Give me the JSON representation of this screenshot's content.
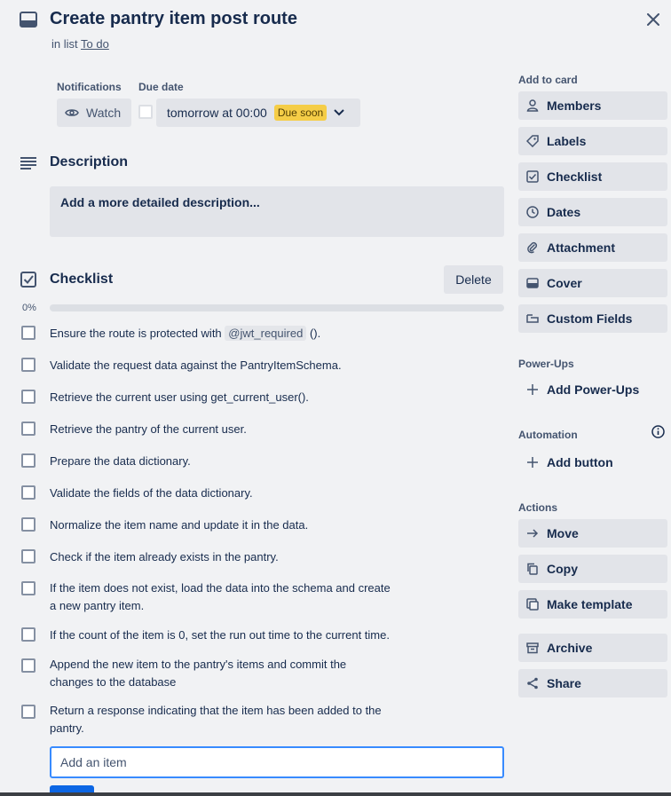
{
  "card": {
    "title": "Create pantry item post route",
    "in_list_prefix": "in list",
    "list_name": "To do"
  },
  "notifications": {
    "label": "Notifications",
    "watch_label": "Watch"
  },
  "due_date": {
    "label": "Due date",
    "value": "tomorrow at 00:00",
    "badge": "Due soon",
    "badge_color": "#f5cd47"
  },
  "description": {
    "title": "Description",
    "placeholder": "Add a more detailed description..."
  },
  "checklist": {
    "title": "Checklist",
    "delete_label": "Delete",
    "progress_percent": 0,
    "progress_label": "0%",
    "items": [
      {
        "text_before": "Ensure the route is protected with",
        "code": "@jwt_required",
        "text_after": "().",
        "checked": false
      },
      {
        "text": "Validate the request data against the PantryItemSchema.",
        "checked": false
      },
      {
        "text": "Retrieve the current user using get_current_user().",
        "checked": false
      },
      {
        "text": "Retrieve the pantry of the current user.",
        "checked": false
      },
      {
        "text": "Prepare the data dictionary.",
        "checked": false
      },
      {
        "text": "Validate the fields of the data dictionary.",
        "checked": false
      },
      {
        "text": "Normalize the item name and update it in the data.",
        "checked": false
      },
      {
        "text": "Check if the item already exists in the pantry.",
        "checked": false
      },
      {
        "line1": "If the item does not exist, load the data into the schema and create",
        "line2": "a new pantry item.",
        "checked": false
      },
      {
        "text": "If the count of the item is 0, set the run out time to the current time.",
        "checked": false
      },
      {
        "line1": "Append the new item to the pantry's items and commit the",
        "line2": "changes to the database",
        "checked": false
      },
      {
        "line1": "Return a response indicating that the item has been added to the",
        "line2": "pantry.",
        "checked": false
      }
    ],
    "add_item_placeholder": "Add an item"
  },
  "sidebar": {
    "add_to_card_label": "Add to card",
    "add_to_card": [
      {
        "label": "Members",
        "icon": "person-icon"
      },
      {
        "label": "Labels",
        "icon": "tag-icon"
      },
      {
        "label": "Checklist",
        "icon": "checklist-icon"
      },
      {
        "label": "Dates",
        "icon": "clock-icon"
      },
      {
        "label": "Attachment",
        "icon": "paperclip-icon"
      },
      {
        "label": "Cover",
        "icon": "cover-icon"
      },
      {
        "label": "Custom Fields",
        "icon": "custom-fields-icon"
      }
    ],
    "powerups_label": "Power-Ups",
    "add_powerups": "Add Power-Ups",
    "automation_label": "Automation",
    "add_button": "Add button",
    "actions_label": "Actions",
    "actions": [
      {
        "label": "Move",
        "icon": "arrow-right-icon"
      },
      {
        "label": "Copy",
        "icon": "copy-icon"
      },
      {
        "label": "Make template",
        "icon": "template-icon"
      },
      {
        "label": "Archive",
        "icon": "archive-icon"
      },
      {
        "label": "Share",
        "icon": "share-icon"
      }
    ]
  },
  "colors": {
    "background": "#f1f2f4",
    "button": "#e2e4e9",
    "accent": "#0c66e4",
    "focus": "#388bff"
  }
}
